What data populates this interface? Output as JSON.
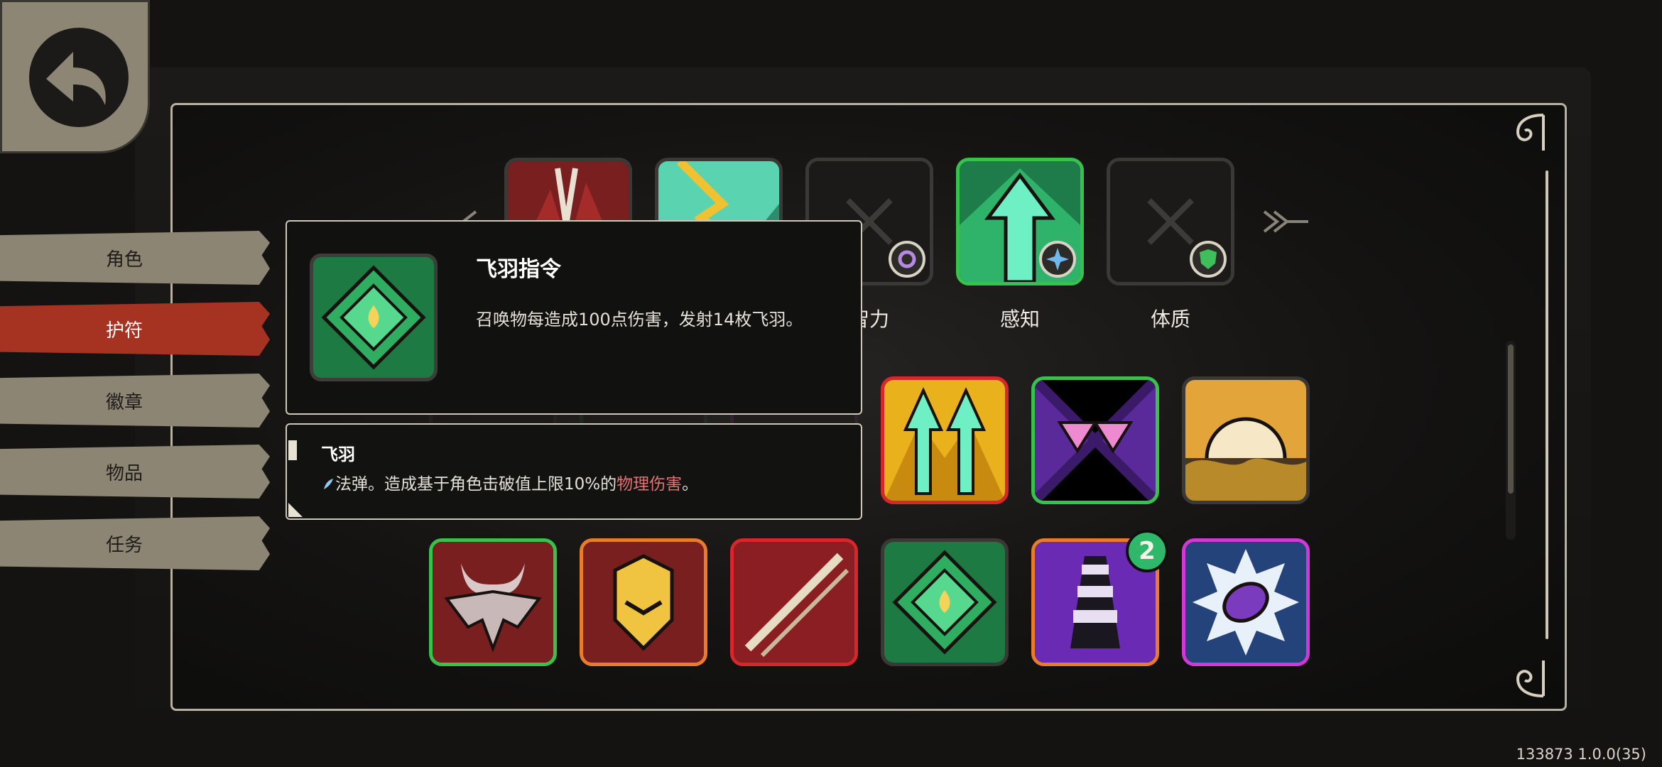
{
  "back_button": {
    "icon": "back-arrow-icon"
  },
  "sidebar": {
    "tabs": [
      {
        "label": "角色",
        "active": false
      },
      {
        "label": "护符",
        "active": true
      },
      {
        "label": "徽章",
        "active": false
      },
      {
        "label": "物品",
        "active": false
      },
      {
        "label": "任务",
        "active": false
      }
    ]
  },
  "attributes": {
    "labels": [
      "智力",
      "感知",
      "体质"
    ],
    "visible_partial_label": "智力"
  },
  "tooltip": {
    "title": "飞羽指令",
    "description": "召唤物每造成100点伤害，发射14枚飞羽。"
  },
  "subtooltip": {
    "title": "飞羽",
    "desc_prefix": "法弹。造成基于角色击破值上限10%的",
    "desc_highlight": "物理伤害",
    "desc_suffix": "。"
  },
  "stack_badge": "2",
  "version": "133873 1.0.0(35)",
  "colors": {
    "green_border": "#37c24c",
    "red_border": "#d9262a",
    "orange_border": "#ea7b2a",
    "magenta_border": "#d238d8",
    "gray_border": "#3a3935",
    "active_tab": "#a63222"
  }
}
